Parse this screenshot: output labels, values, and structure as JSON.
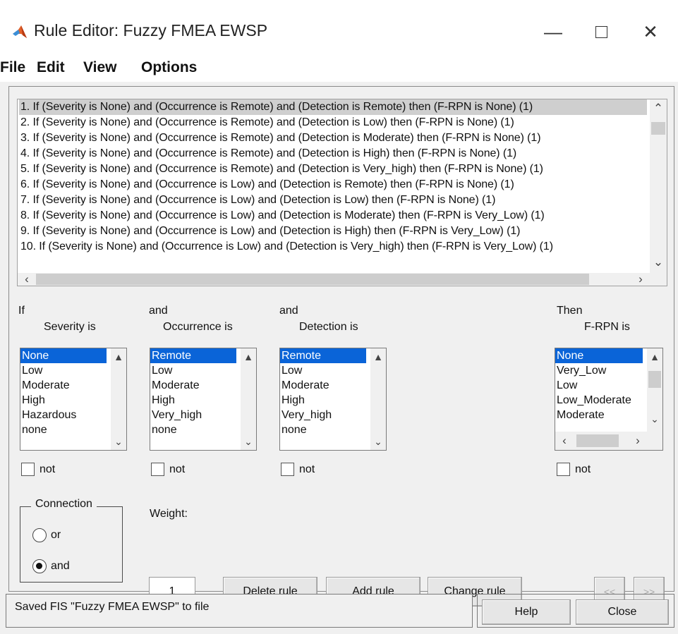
{
  "window": {
    "title": "Rule Editor: Fuzzy FMEA EWSP",
    "minimize_symbol": "—",
    "close_symbol": "✕"
  },
  "menu": [
    {
      "label": "File"
    },
    {
      "label": "Edit"
    },
    {
      "label": "View"
    },
    {
      "label": "Options"
    }
  ],
  "rules": [
    "1. If (Severity is None) and (Occurrence is Remote) and (Detection is Remote) then (F-RPN is None) (1)",
    "2. If (Severity is None) and (Occurrence is Remote) and (Detection is Low) then (F-RPN is None) (1)",
    "3. If (Severity is None) and (Occurrence is Remote) and (Detection is Moderate) then (F-RPN is None) (1)",
    "4. If (Severity is None) and (Occurrence is Remote) and (Detection is High) then (F-RPN is None) (1)",
    "5. If (Severity is None) and (Occurrence is Remote) and (Detection is Very_high) then (F-RPN is None) (1)",
    "6. If (Severity is None) and (Occurrence is Low) and (Detection is Remote) then (F-RPN is None) (1)",
    "7. If (Severity is None) and (Occurrence is Low) and (Detection is Low) then (F-RPN is None) (1)",
    "8. If (Severity is None) and (Occurrence is Low) and (Detection is Moderate) then (F-RPN is Very_Low) (1)",
    "9. If (Severity is None) and (Occurrence is Low) and (Detection is High) then (F-RPN is Very_Low) (1)",
    "10. If (Severity is None) and (Occurrence is Low) and (Detection is Very_high) then (F-RPN is Very_Low) (1)"
  ],
  "columns": {
    "severity": {
      "prefix": "If",
      "label": "Severity is",
      "options": [
        "None",
        "Low",
        "Moderate",
        "High",
        "Hazardous",
        "none"
      ],
      "not_label": "not"
    },
    "occurrence": {
      "prefix": "and",
      "label": "Occurrence is",
      "options": [
        "Remote",
        "Low",
        "Moderate",
        "High",
        "Very_high",
        "none"
      ],
      "not_label": "not"
    },
    "detection": {
      "prefix": "and",
      "label": "Detection is",
      "options": [
        "Remote",
        "Low",
        "Moderate",
        "High",
        "Very_high",
        "none"
      ],
      "not_label": "not"
    },
    "frpn": {
      "prefix": "Then",
      "label": "F-RPN is",
      "options": [
        "None",
        "Very_Low",
        "Low",
        "Low_Moderate",
        "Moderate"
      ],
      "not_label": "not"
    }
  },
  "connection": {
    "title": "Connection",
    "options": [
      "or",
      "and"
    ],
    "selected": "and"
  },
  "weight": {
    "label": "Weight:",
    "value": "1"
  },
  "buttons": {
    "delete": "Delete rule",
    "add": "Add rule",
    "change": "Change rule",
    "prev": "<<",
    "next": ">>",
    "help": "Help",
    "close": "Close"
  },
  "status": "Saved FIS \"Fuzzy FMEA EWSP\" to file",
  "colors": {
    "selection": "#0a64d8",
    "panel": "#f0f0f0"
  }
}
